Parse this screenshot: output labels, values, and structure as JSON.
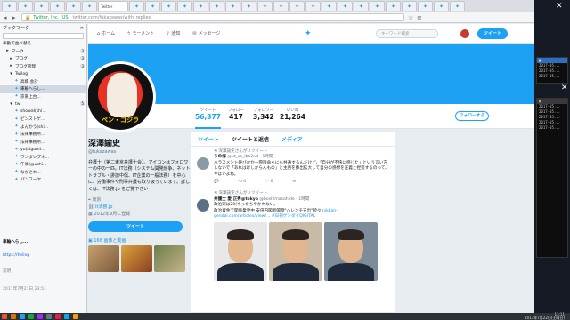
{
  "browser": {
    "active_tab_label": "Twitter",
    "url_site": "Twitter, Inc. [US]",
    "url_host": "twitter.com/fukazawas/with_replies"
  },
  "sidebar": {
    "title": "ブックマーク",
    "menu_label": "手動で並べ替え",
    "items": [
      {
        "label": "マーク",
        "count": "3"
      },
      {
        "label": "ブログ",
        "count": "3"
      },
      {
        "label": "ブログ管理",
        "count": "3"
      },
      {
        "label": "Twilog",
        "count": ""
      },
      {
        "label": "高橋.会計",
        "count": ""
      },
      {
        "label": "車輪へらし...",
        "count": ""
      },
      {
        "label": "京東上台...",
        "count": ""
      },
      {
        "label": "tw",
        "count": "5"
      },
      {
        "label": "showal(shi...",
        "count": ""
      },
      {
        "label": "ピンストゲ...",
        "count": ""
      },
      {
        "label": "よんかう(shi...",
        "count": ""
      },
      {
        "label": "法律事務所...",
        "count": ""
      },
      {
        "label": "法律事務所...",
        "count": ""
      },
      {
        "label": "yu(kigumi...",
        "count": ""
      },
      {
        "label": "ワンダレプネ...",
        "count": ""
      },
      {
        "label": "午後(@ushi...",
        "count": ""
      },
      {
        "label": "ながさわ...",
        "count": ""
      },
      {
        "label": "パンフーヤ...",
        "count": ""
      }
    ],
    "preview": {
      "title": "車輪へらし...",
      "url": "https://twilog",
      "label": "説明",
      "date": "2017年7月21日 23:51"
    }
  },
  "twitter_nav": {
    "home": "ホーム",
    "moments": "モーメント",
    "notifications": "通知",
    "messages": "メッセージ",
    "search_placeholder": "キーワード検索",
    "tweet_button": "ツイート"
  },
  "profile": {
    "avatar_text": "ペン・ゴジラ",
    "name": "深澤諭史",
    "handle": "@fukazawas",
    "bio": "弁護士（第二東京弁護士会）。アイコンはフォロワーの中の一匹。IT法務（システム開発紛争、ネットトラブル・誹謗中傷、IT企業の一般法務）を中心に、労働事件や刑事弁護も取り扱っています。詳しくは、IT法務.jp をご覧下さい",
    "location": "東京",
    "website": "it法務.jp",
    "joined": "2012年9月に登録",
    "tweet_button": "ツイート",
    "media_link": "168 画像と動画"
  },
  "stats": [
    {
      "label": "ツイート",
      "value": "56,377"
    },
    {
      "label": "フォロー",
      "value": "417"
    },
    {
      "label": "フォロワー",
      "value": "3,342"
    },
    {
      "label": "いいね",
      "value": "21,264"
    }
  ],
  "follow_button": "フォローする",
  "timeline": {
    "tabs": [
      "ツイート",
      "ツイートと返信",
      "メディア"
    ],
    "tweets": [
      {
        "retweeted_by": "深澤諭史さんがリツイート",
        "name": "うの梅",
        "handle": "@ut_so_lba2nd · 1時間",
        "text": "ハラスメント呼びかかー際限命ゃにも共通するんだけど、「自分が不快に感じた」という言い方しないで「あれはけしからんもの」と主語を挿出拡大して自分の感想を正義と捏造するのって、やばいよね。",
        "replies": "",
        "retweets": "4",
        "likes": "6"
      },
      {
        "retweeted_by": "深澤諭史さんがリツイート",
        "name": "弁護士 愛 正秀@tokyo",
        "handle": "@hoshimasahide · 1時間",
        "text": "政治家は20(やったちやかれない。",
        "text2": "政治資金で関係業界中 安倍内閣新閣僚\"ハレンチ支出\"続々 ",
        "link": "nikkan-gendai.com/articles/view/... #日刊ゲンダイDIGITAL"
      }
    ]
  },
  "taskbar": {
    "time": "13:11",
    "date": "2017年7月22日(土曜日)"
  },
  "desktop": {
    "term1": [
      "2017-05...",
      "2017-05...",
      "2017-05..."
    ],
    "term2": [
      "2017-05...",
      "2017-05...",
      "2017-05...",
      "2017-05...",
      "2017-05..."
    ]
  },
  "colors": {
    "twitter_blue": "#1da1f2",
    "avatar_red": "#e73324"
  }
}
